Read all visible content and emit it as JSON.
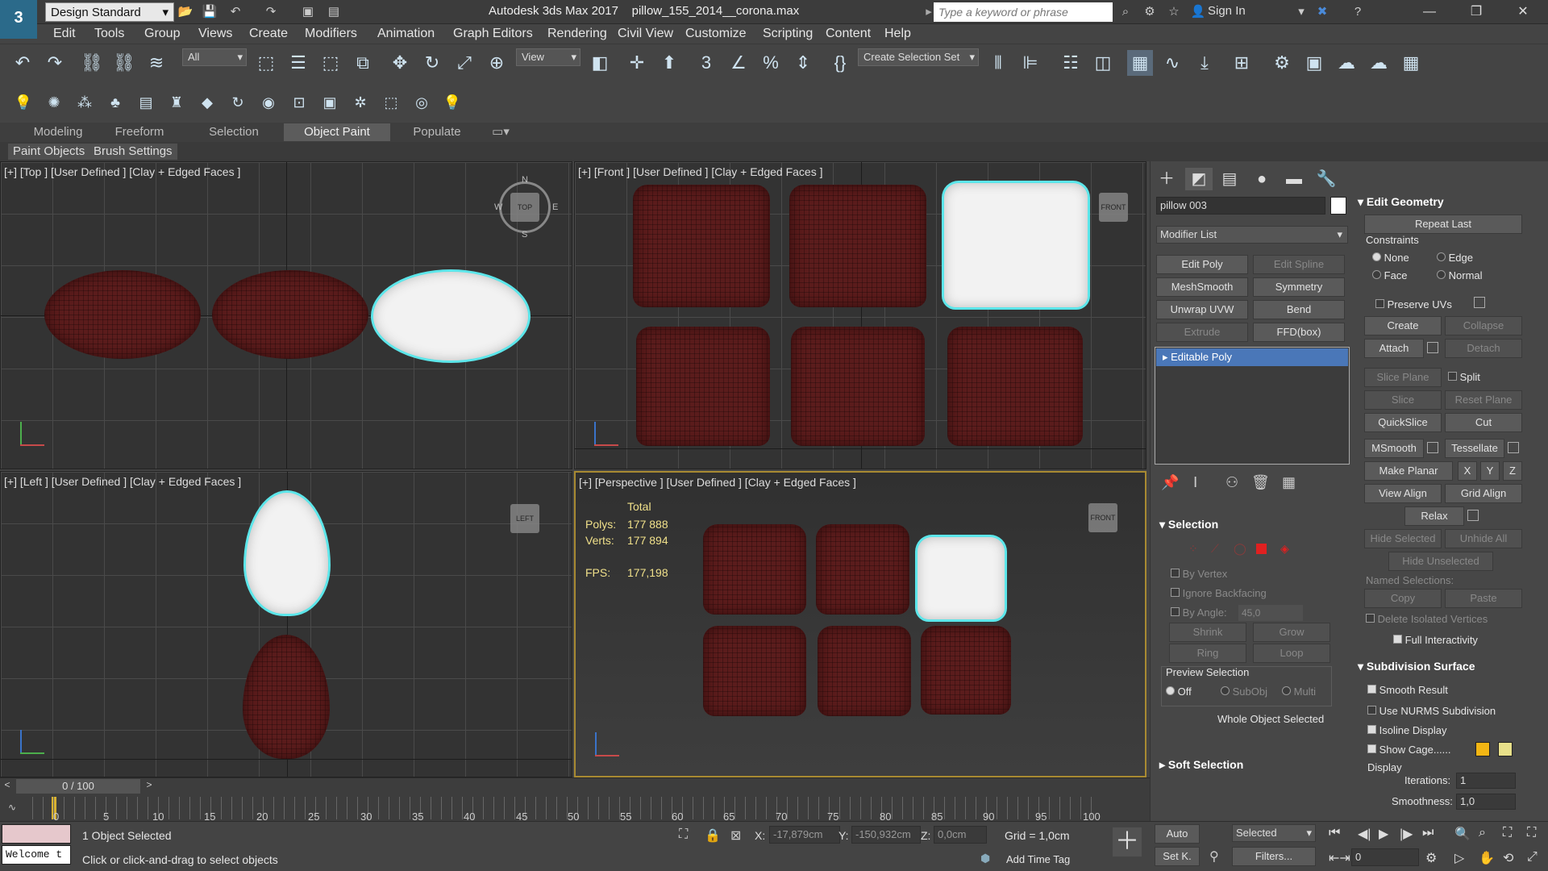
{
  "titlebar": {
    "workspace": "Design Standard",
    "app_title": "Autodesk 3ds Max 2017",
    "file_name": "pillow_155_2014__corona.max",
    "search_placeholder": "Type a keyword or phrase",
    "sign_in": "Sign In",
    "logo_text": "3"
  },
  "menu": [
    "Edit",
    "Tools",
    "Group",
    "Views",
    "Create",
    "Modifiers",
    "Animation",
    "Graph Editors",
    "Rendering",
    "Civil View",
    "Customize",
    "Scripting",
    "Content",
    "Help"
  ],
  "toolbar": {
    "filter_value": "All",
    "ref_coord_value": "View",
    "selection_set_value": "Create Selection Set"
  },
  "ribbon": {
    "tabs": [
      "Modeling",
      "Freeform",
      "Selection",
      "Object Paint",
      "Populate"
    ],
    "active_tab": "Object Paint",
    "subtabs": [
      "Paint Objects",
      "Brush Settings"
    ]
  },
  "viewports": {
    "top": "[+] [Top ] [User Defined ] [Clay + Edged Faces ]",
    "front": "[+] [Front ] [User Defined ] [Clay + Edged Faces ]",
    "left": "[+] [Left ] [User Defined ] [Clay + Edged Faces ]",
    "perspective": "[+] [Perspective ] [User Defined ] [Clay + Edged Faces ]",
    "cube_top": "TOP",
    "cube_front": "FRONT",
    "cube_left": "LEFT",
    "compass": {
      "n": "N",
      "s": "S",
      "e": "E",
      "w": "W"
    },
    "stats": {
      "total_label": "Total",
      "polys_label": "Polys:",
      "polys": "177 888",
      "verts_label": "Verts:",
      "verts": "177 894",
      "fps_label": "FPS:",
      "fps": "177,198"
    }
  },
  "command_panel": {
    "object_name": "pillow 003",
    "modifier_list": "Modifier List",
    "modifier_buttons": [
      "Edit Poly",
      "Edit Spline",
      "MeshSmooth",
      "Symmetry",
      "Unwrap UVW",
      "Bend",
      "Extrude",
      "FFD(box)"
    ],
    "stack_item": "Editable Poly",
    "selection": {
      "header": "Selection",
      "by_vertex": "By Vertex",
      "ignore_backfacing": "Ignore Backfacing",
      "by_angle": "By Angle:",
      "angle_value": "45,0",
      "shrink": "Shrink",
      "grow": "Grow",
      "ring": "Ring",
      "loop": "Loop",
      "preview_selection": "Preview Selection",
      "off": "Off",
      "subobj": "SubObj",
      "multi": "Multi",
      "status": "Whole Object Selected"
    },
    "soft_selection": "Soft Selection",
    "edit_geometry": {
      "header": "Edit Geometry",
      "repeat_last": "Repeat Last",
      "constraints": "Constraints",
      "none": "None",
      "edge": "Edge",
      "face": "Face",
      "normal": "Normal",
      "preserve_uvs": "Preserve UVs",
      "create": "Create",
      "collapse": "Collapse",
      "attach": "Attach",
      "detach": "Detach",
      "slice_plane": "Slice Plane",
      "split": "Split",
      "slice": "Slice",
      "reset_plane": "Reset Plane",
      "quickslice": "QuickSlice",
      "cut": "Cut",
      "msmooth": "MSmooth",
      "tessellate": "Tessellate",
      "make_planar": "Make Planar",
      "x": "X",
      "y": "Y",
      "z": "Z",
      "view_align": "View Align",
      "grid_align": "Grid Align",
      "relax": "Relax",
      "hide_selected": "Hide Selected",
      "unhide_all": "Unhide All",
      "hide_unselected": "Hide Unselected",
      "named_selections": "Named Selections:",
      "copy": "Copy",
      "paste": "Paste",
      "delete_isolated": "Delete Isolated Vertices",
      "full_interactivity": "Full Interactivity"
    },
    "subdivision": {
      "header": "Subdivision Surface",
      "smooth_result": "Smooth Result",
      "use_nurms": "Use NURMS Subdivision",
      "isoline": "Isoline Display",
      "show_cage": "Show Cage......",
      "display": "Display",
      "iterations_label": "Iterations:",
      "iterations": "1",
      "smoothness_label": "Smoothness:",
      "smoothness": "1,0"
    },
    "cage_colors": [
      "#f2b614",
      "#e8e08a"
    ]
  },
  "timeline": {
    "frame": "0 / 100",
    "ticks": [
      "0",
      "5",
      "10",
      "15",
      "20",
      "25",
      "30",
      "35",
      "40",
      "45",
      "50",
      "55",
      "60",
      "65",
      "70",
      "75",
      "80",
      "85",
      "90",
      "95",
      "100"
    ]
  },
  "status": {
    "maxscript": "Welcome t",
    "selected": "1 Object Selected",
    "prompt": "Click or click-and-drag to select objects",
    "x_label": "X:",
    "x": "-17,879cm",
    "y_label": "Y:",
    "y": "-150,932cm",
    "z_label": "Z:",
    "z": "0,0cm",
    "grid": "Grid = 1,0cm",
    "add_time_tag": "Add Time Tag",
    "auto": "Auto",
    "set_key": "Set K.",
    "selected_dd": "Selected",
    "filters": "Filters...",
    "frame_value": "0"
  }
}
